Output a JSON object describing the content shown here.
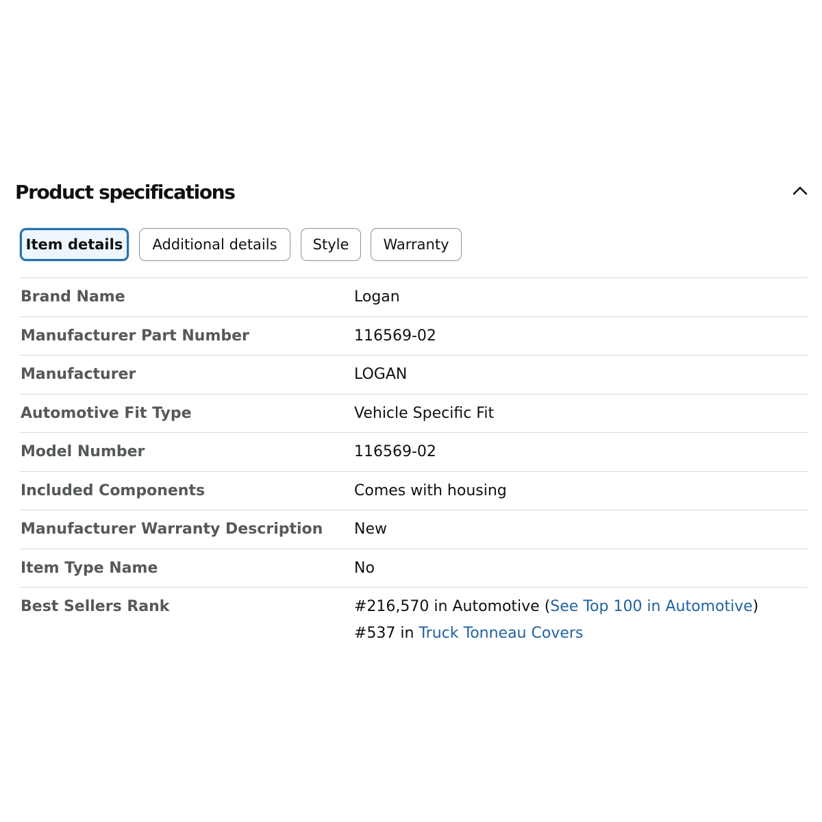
{
  "section": {
    "title": "Product specifications",
    "collapse_icon": "chevron-up-icon"
  },
  "tabs": [
    {
      "label": "Item details",
      "active": true
    },
    {
      "label": "Additional details",
      "active": false
    },
    {
      "label": "Style",
      "active": false
    },
    {
      "label": "Warranty",
      "active": false
    }
  ],
  "specs": [
    {
      "label": "Brand Name",
      "value": "Logan"
    },
    {
      "label": "Manufacturer Part Number",
      "value": "116569-02"
    },
    {
      "label": "Manufacturer",
      "value": "LOGAN"
    },
    {
      "label": "Automotive Fit Type",
      "value": "Vehicle Specific Fit"
    },
    {
      "label": "Model Number",
      "value": "116569-02"
    },
    {
      "label": "Included Components",
      "value": "Comes with housing"
    },
    {
      "label": "Manufacturer Warranty Description",
      "value": "New"
    },
    {
      "label": "Item Type Name",
      "value": "No"
    }
  ],
  "best_sellers": {
    "label": "Best Sellers Rank",
    "rank1": {
      "prefix": "#216,570 in Automotive (",
      "link": "See Top 100 in Automotive",
      "suffix": ")"
    },
    "rank2": {
      "prefix": "#537 in ",
      "link": "Truck Tonneau Covers"
    }
  },
  "colors": {
    "link": "#2162a1",
    "active_tab_border": "#2a6fa8",
    "active_tab_bg": "#edf6fc",
    "label_text": "#565959",
    "divider": "#d5d9d9"
  }
}
